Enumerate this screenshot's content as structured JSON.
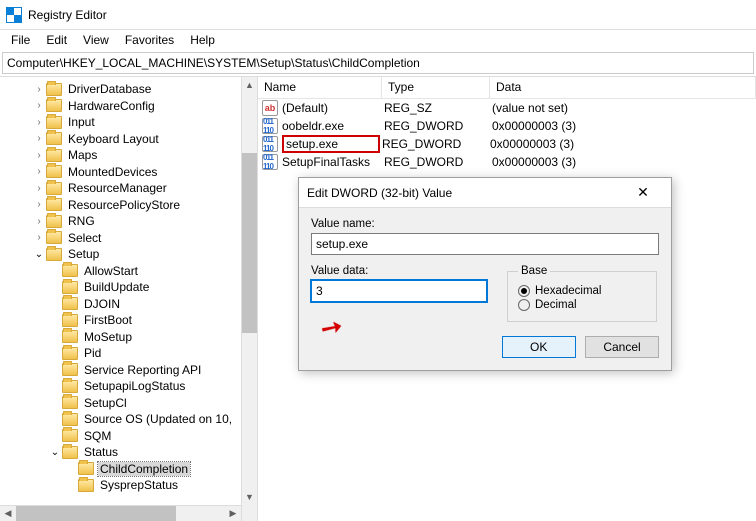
{
  "window": {
    "title": "Registry Editor"
  },
  "menubar": [
    "File",
    "Edit",
    "View",
    "Favorites",
    "Help"
  ],
  "address": "Computer\\HKEY_LOCAL_MACHINE\\SYSTEM\\Setup\\Status\\ChildCompletion",
  "tree": [
    {
      "depth": 2,
      "chev": ">",
      "label": "DriverDatabase"
    },
    {
      "depth": 2,
      "chev": ">",
      "label": "HardwareConfig"
    },
    {
      "depth": 2,
      "chev": ">",
      "label": "Input"
    },
    {
      "depth": 2,
      "chev": ">",
      "label": "Keyboard Layout"
    },
    {
      "depth": 2,
      "chev": ">",
      "label": "Maps"
    },
    {
      "depth": 2,
      "chev": ">",
      "label": "MountedDevices"
    },
    {
      "depth": 2,
      "chev": ">",
      "label": "ResourceManager"
    },
    {
      "depth": 2,
      "chev": ">",
      "label": "ResourcePolicyStore"
    },
    {
      "depth": 2,
      "chev": ">",
      "label": "RNG"
    },
    {
      "depth": 2,
      "chev": ">",
      "label": "Select"
    },
    {
      "depth": 2,
      "chev": "v",
      "label": "Setup",
      "open": true
    },
    {
      "depth": 3,
      "chev": "",
      "label": "AllowStart"
    },
    {
      "depth": 3,
      "chev": "",
      "label": "BuildUpdate"
    },
    {
      "depth": 3,
      "chev": "",
      "label": "DJOIN"
    },
    {
      "depth": 3,
      "chev": "",
      "label": "FirstBoot"
    },
    {
      "depth": 3,
      "chev": "",
      "label": "MoSetup"
    },
    {
      "depth": 3,
      "chev": "",
      "label": "Pid"
    },
    {
      "depth": 3,
      "chev": "",
      "label": "Service Reporting API"
    },
    {
      "depth": 3,
      "chev": "",
      "label": "SetupapiLogStatus"
    },
    {
      "depth": 3,
      "chev": "",
      "label": "SetupCl"
    },
    {
      "depth": 3,
      "chev": "",
      "label": "Source OS (Updated on 10,"
    },
    {
      "depth": 3,
      "chev": "",
      "label": "SQM"
    },
    {
      "depth": 3,
      "chev": "v",
      "label": "Status",
      "open": true
    },
    {
      "depth": 4,
      "chev": "",
      "label": "ChildCompletion",
      "selected": true
    },
    {
      "depth": 4,
      "chev": "",
      "label": "SysprepStatus"
    }
  ],
  "list": {
    "columns": [
      "Name",
      "Type",
      "Data"
    ],
    "rows": [
      {
        "icon": "ab",
        "name": "(Default)",
        "type": "REG_SZ",
        "data": "(value not set)"
      },
      {
        "icon": "bin",
        "name": "oobeldr.exe",
        "type": "REG_DWORD",
        "data": "0x00000003 (3)"
      },
      {
        "icon": "bin",
        "name": "setup.exe",
        "type": "REG_DWORD",
        "data": "0x00000003 (3)",
        "boxed": true
      },
      {
        "icon": "bin",
        "name": "SetupFinalTasks",
        "type": "REG_DWORD",
        "data": "0x00000003 (3)"
      }
    ]
  },
  "dialog": {
    "title": "Edit DWORD (32-bit) Value",
    "value_name_label": "Value name:",
    "value_name": "setup.exe",
    "value_data_label": "Value data:",
    "value_data": "3",
    "base_label": "Base",
    "hex_label": "Hexadecimal",
    "dec_label": "Decimal",
    "base_selected": "hex",
    "ok": "OK",
    "cancel": "Cancel"
  }
}
